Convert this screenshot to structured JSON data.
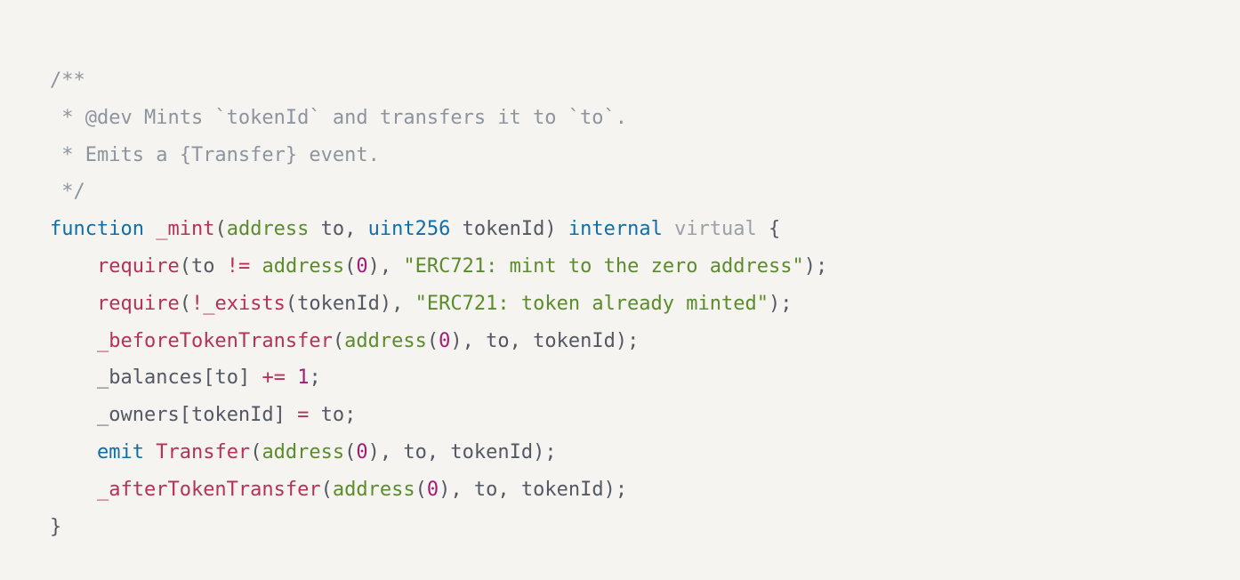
{
  "code": {
    "comment_l1": "/**",
    "comment_l2": " * @dev Mints `tokenId` and transfers it to `to`.",
    "comment_l3": " * Emits a {Transfer} event.",
    "comment_l4": " */",
    "kw_function": "function",
    "fn_mint": "_mint",
    "paren_open": "(",
    "paren_close": ")",
    "type_address": "address",
    "param_to": "to",
    "comma_sp": ", ",
    "type_uint256": "uint256",
    "param_tokenId": "tokenId",
    "kw_internal": "internal",
    "kw_virtual": "virtual",
    "brace_open": "{",
    "brace_close": "}",
    "require": "require",
    "op_neq": "!=",
    "num_zero": "0",
    "str_mint_zero": "\"ERC721: mint to the zero address\"",
    "semicolon": ";",
    "op_not": "!",
    "fn_exists": "_exists",
    "str_already": "\"ERC721: token already minted\"",
    "fn_before": "_beforeTokenTransfer",
    "balances": "_balances",
    "bracket_open": "[",
    "bracket_close": "]",
    "op_pluseq": "+=",
    "num_one": "1",
    "owners": "_owners",
    "op_eq": "=",
    "kw_emit": "emit",
    "cls_transfer": "Transfer",
    "fn_after": "_afterTokenTransfer",
    "indent1": "    ",
    "sp": " "
  }
}
